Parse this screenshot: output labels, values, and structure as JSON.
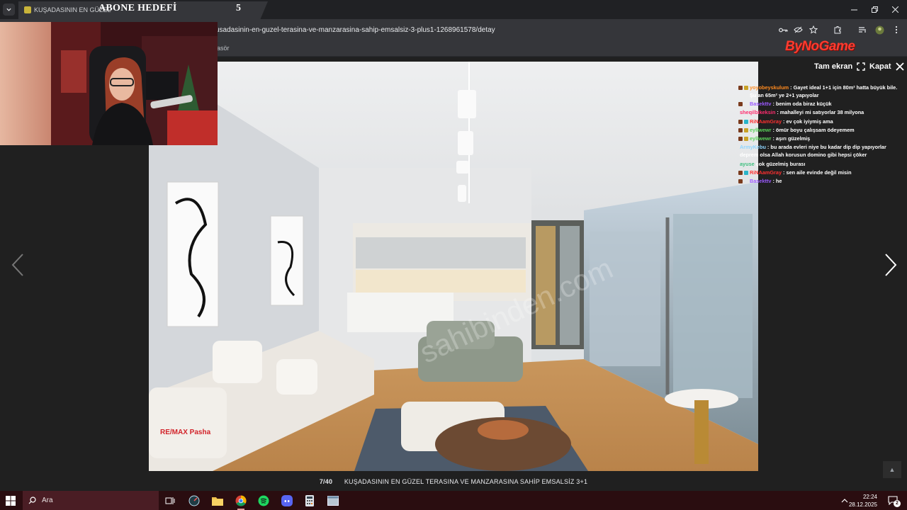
{
  "browser": {
    "tab_title": "KUŞADASININ EN GÜZEL",
    "url": "usadasinin-en-guzel-terasina-ve-manzarasina-sahip-emsalsiz-3-plus1-1268961578/detay",
    "bookmark_label": "asör"
  },
  "stream_overlay": {
    "goal_label": "ABONE HEDEFİ",
    "goal_value": "5",
    "logo_text": "ByNoGame"
  },
  "viewer": {
    "fullscreen_label": "Tam ekran",
    "close_label": "Kapat",
    "counter": "7/40",
    "caption": "KUŞADASININ EN GÜZEL TERASINA VE MANZARASINA SAHİP EMSALSİZ 3+1",
    "photo_watermark": "RE/MAX Pasha"
  },
  "chat": [
    {
      "user": "yoyobeyskulum",
      "user_color": "#ff8a1e",
      "text": "Gayet ideal 1+1 için 80m² hatta büyük bile. Şu an 65m² ye 2+1 yapıyolar",
      "badges": [
        "#7a3b1d",
        "#c9a227"
      ]
    },
    {
      "user": "Basekttv",
      "user_color": "#9b59ff",
      "text": "benim oda biraz küçük",
      "badges": [
        "#7a3b1d"
      ]
    },
    {
      "user": "sheqilbikeksin",
      "user_color": "#ff2d6f",
      "text": "mahalleyi mi satıyorlar 38 milyona",
      "badges": []
    },
    {
      "user": "RiNAamGray",
      "user_color": "#ff3030",
      "text": "ev çok iyiymiş ama",
      "badges": [
        "#7a3b1d",
        "#2bb5c9"
      ]
    },
    {
      "user": "eyllwewr",
      "user_color": "#5ad35a",
      "text": "ömür boyu çalışsam ödeyemem",
      "badges": [
        "#7a3b1d",
        "#c9a227"
      ]
    },
    {
      "user": "eyllwewr",
      "user_color": "#5ad35a",
      "text": "aşırı güzelmiş",
      "badges": [
        "#7a3b1d",
        "#c9a227"
      ]
    },
    {
      "user": "ArmyKebu",
      "user_color": "#8fd6ff",
      "text": "bu arada evleri niye bu kadar dip dip yapıyorlar deprem olsa Allah korusun domino gibi hepsi çöker",
      "badges": []
    },
    {
      "user": "ayuse",
      "user_color": "#3fbf7f",
      "text": "çok güzelmiş burası",
      "badges": []
    },
    {
      "user": "RiNAamGray",
      "user_color": "#ff3030",
      "text": "sen aile evinde değil misin",
      "badges": [
        "#7a3b1d",
        "#2bb5c9"
      ]
    },
    {
      "user": "Basekttv",
      "user_color": "#9b59ff",
      "text": "he",
      "badges": [
        "#7a3b1d"
      ]
    }
  ],
  "taskbar": {
    "search_placeholder": "Ara",
    "time": "22:24",
    "date": "28.12.2025",
    "notification_count": "2"
  }
}
